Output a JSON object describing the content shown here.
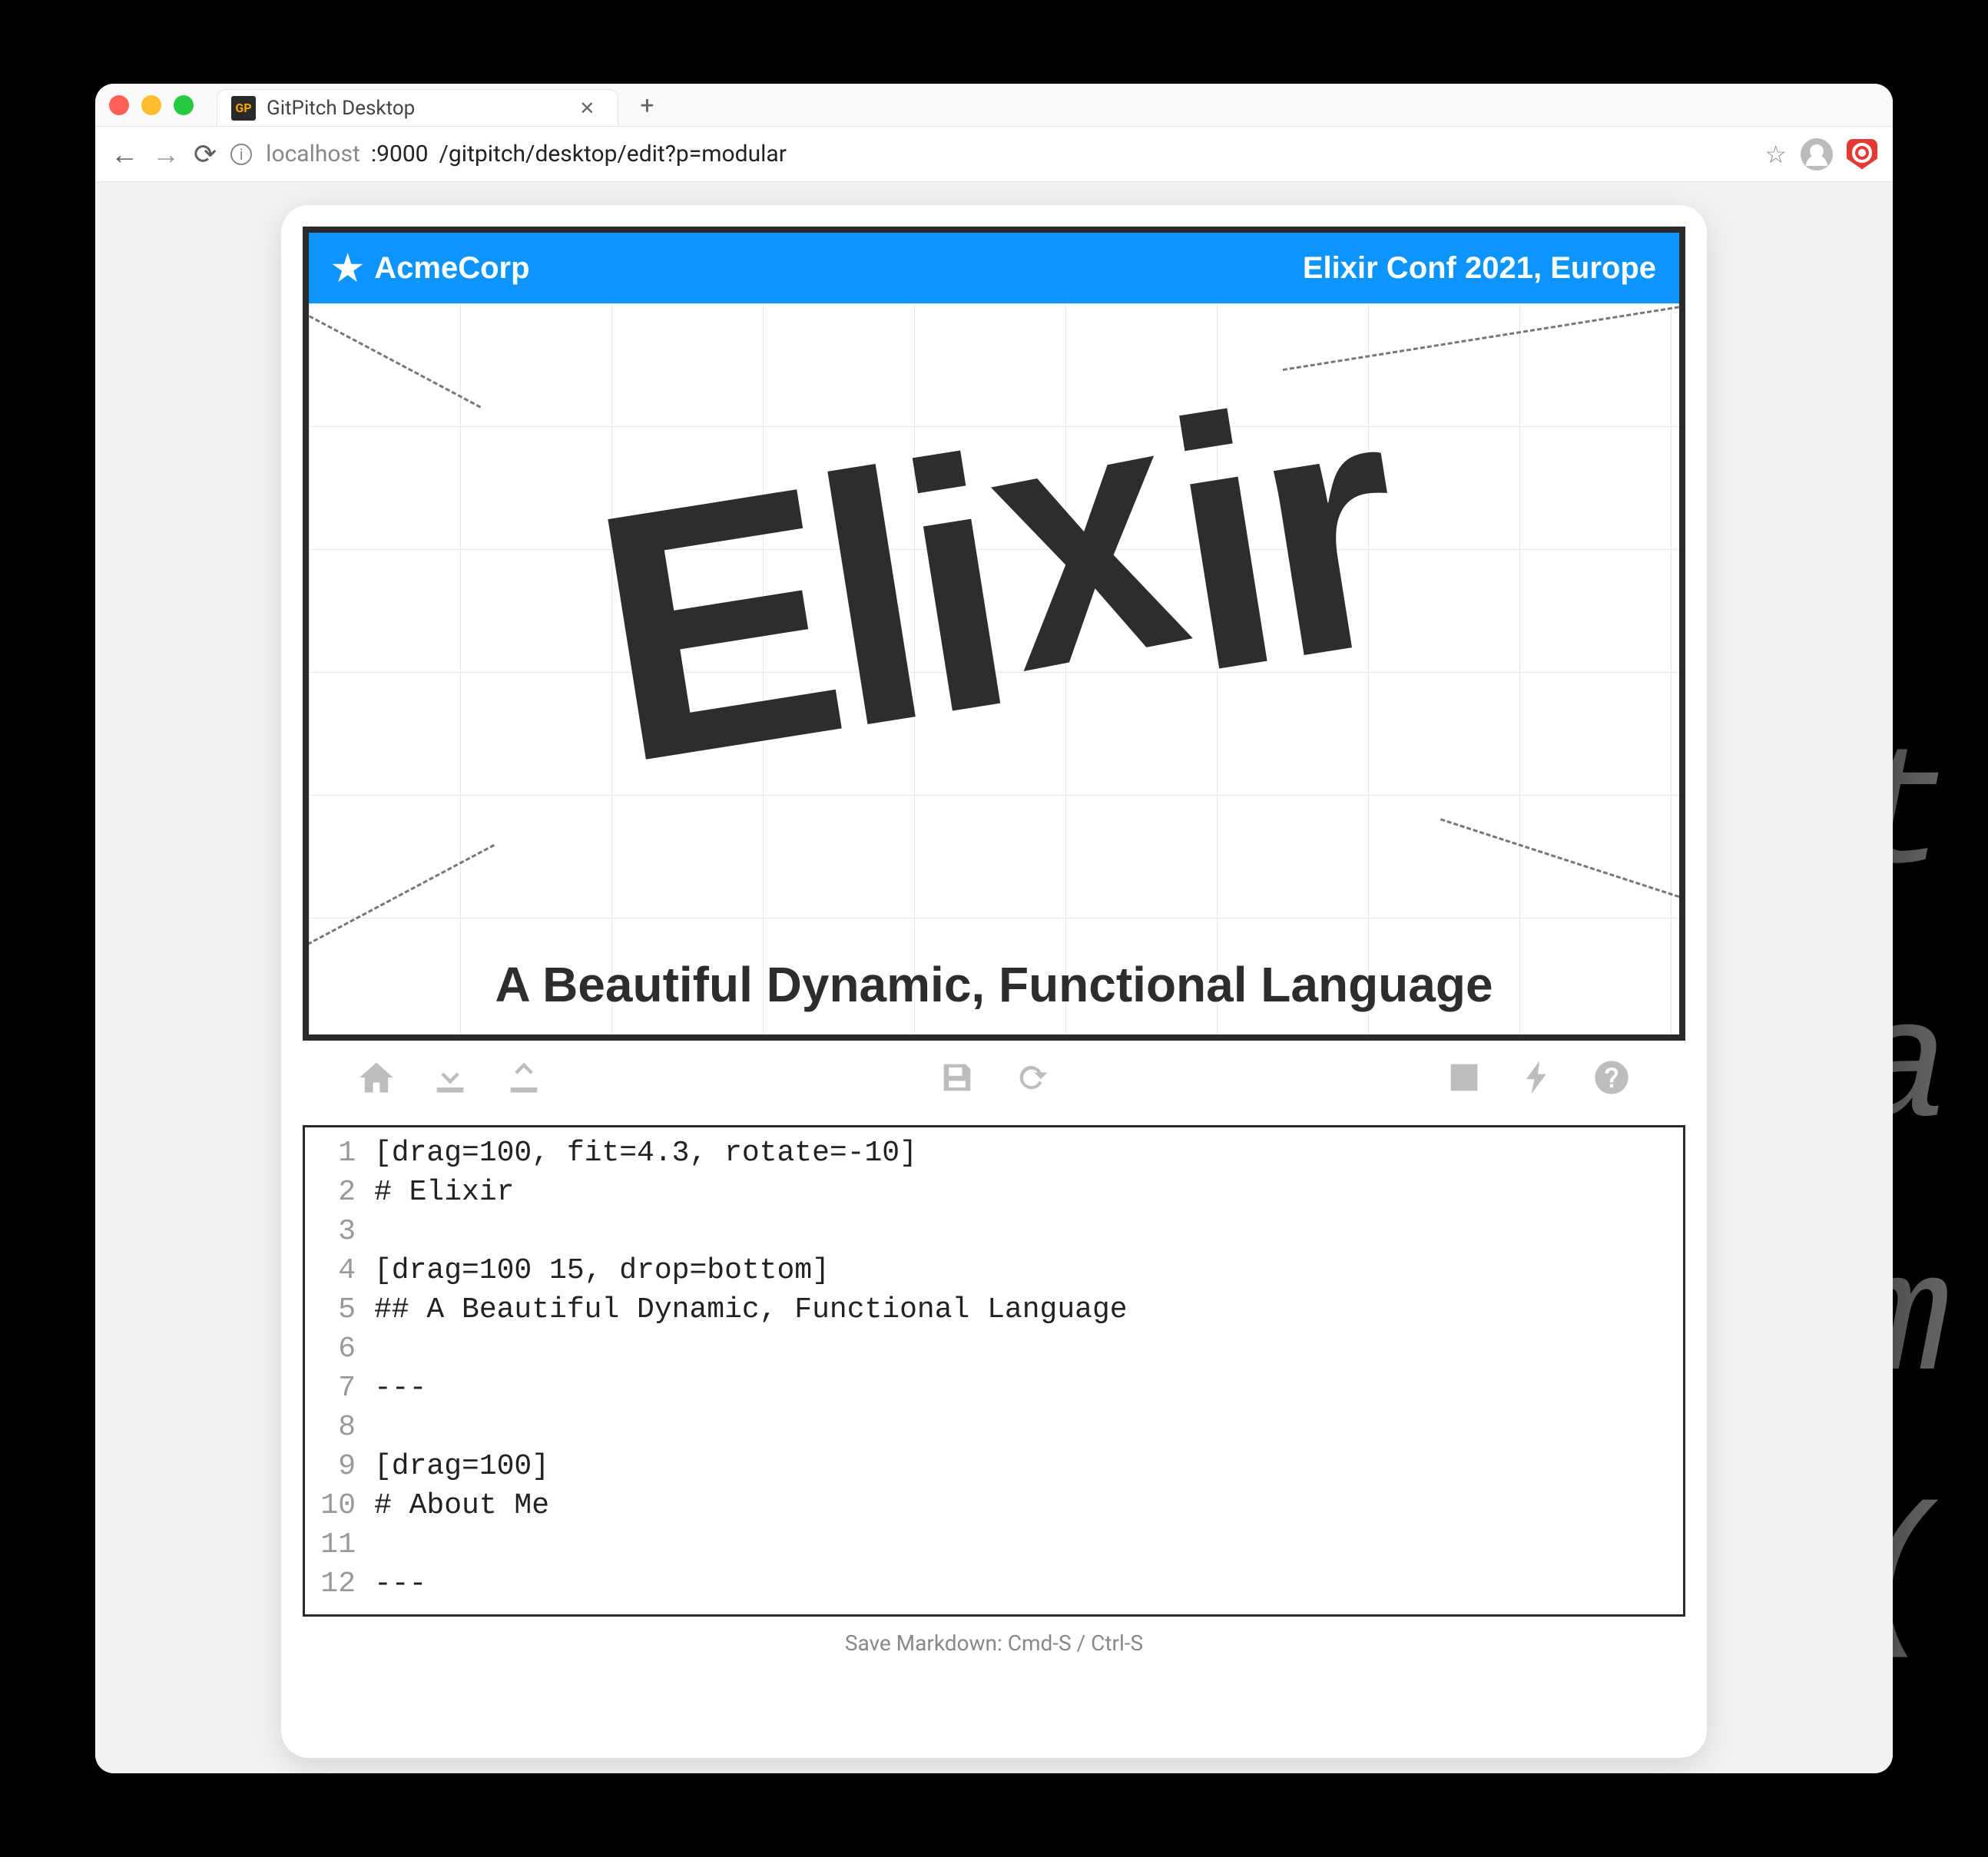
{
  "bg_code_lines": [
    "et",
    "pa",
    "nam",
    "od("
  ],
  "browser": {
    "tab_title": "GitPitch Desktop",
    "favicon_text": "GP",
    "url_host_muted": "localhost",
    "url_port": ":9000",
    "url_path": "/gitpitch/desktop/edit?p=modular"
  },
  "slide": {
    "brand": "AcmeCorp",
    "event": "Elixir Conf 2021, Europe",
    "title": "Elixir",
    "subtitle": "A Beautiful Dynamic, Functional Language"
  },
  "toolbar": {
    "home": "home",
    "download": "download",
    "upload": "upload",
    "save": "save",
    "refresh": "refresh",
    "image": "image",
    "bolt": "bolt",
    "help": "help"
  },
  "editor": {
    "lines": [
      "[drag=100, fit=4.3, rotate=-10]",
      "# Elixir",
      "",
      "[drag=100 15, drop=bottom]",
      "## A Beautiful Dynamic, Functional Language",
      "",
      "---",
      "",
      "[drag=100]",
      "# About Me",
      "",
      "---"
    ]
  },
  "footer": "Save Markdown: Cmd-S / Ctrl-S"
}
